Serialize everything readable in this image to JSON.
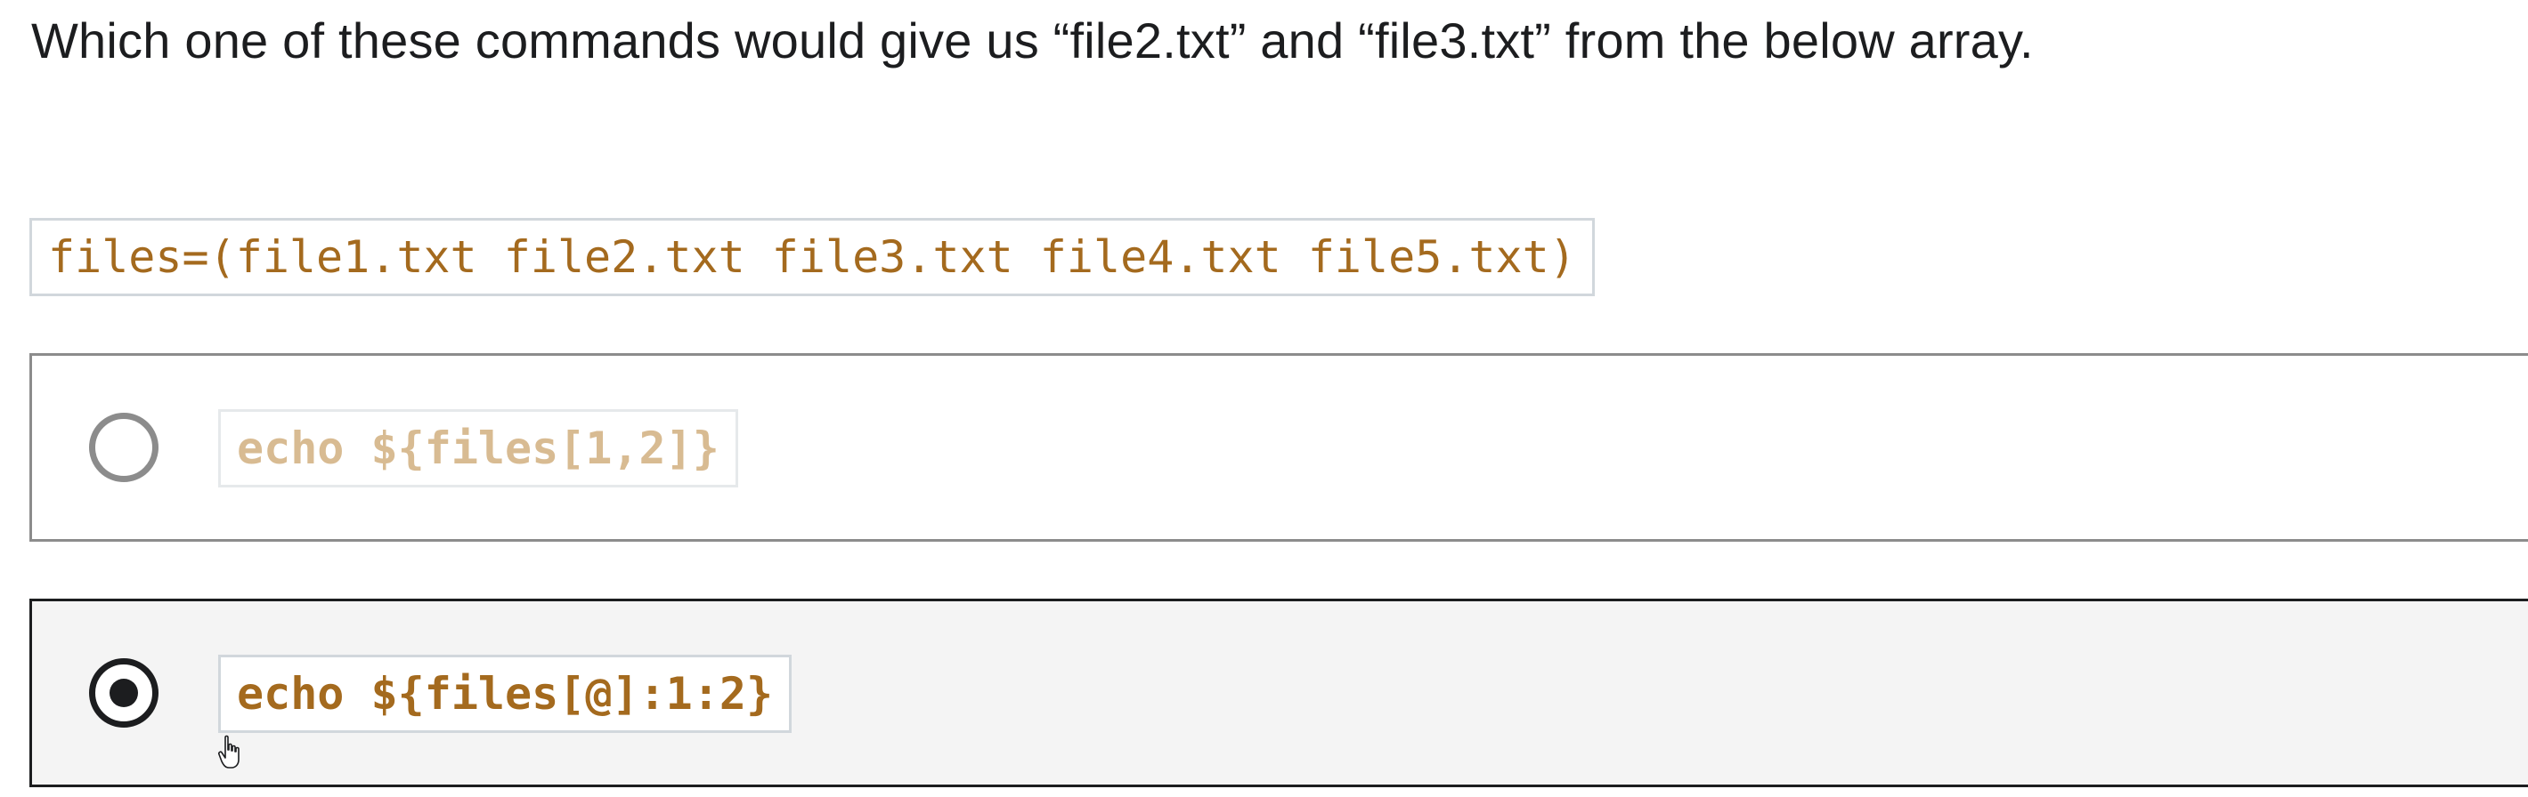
{
  "question": {
    "text": "Which one of these commands would give us “file2.txt” and “file3.txt” from the below array."
  },
  "code_snippet": {
    "text": "files=(file1.txt file2.txt file3.txt file4.txt file5.txt)"
  },
  "options": [
    {
      "label": "echo ${files[1,2]}",
      "selected": false
    },
    {
      "label": "echo ${files[@]:1:2}",
      "selected": true
    }
  ],
  "colors": {
    "code_text": "#a46a1e",
    "code_text_muted": "#d8bb92",
    "selected_border": "#1c1d1f",
    "unselected_border": "#8c8c8c",
    "selected_background": "#f4f4f4"
  },
  "icons": {
    "cursor": "hand-pointer-icon"
  }
}
